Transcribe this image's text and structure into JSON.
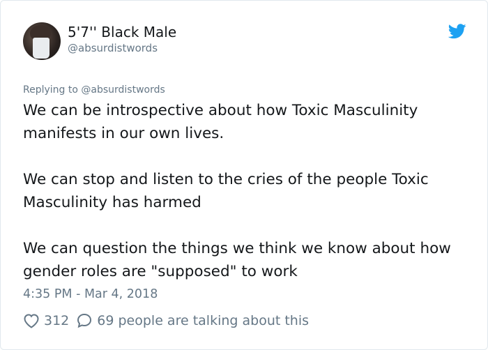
{
  "tweet": {
    "display_name": "5'7'' Black Male",
    "handle": "@absurdistwords",
    "replying_to": "Replying to @absurdistwords",
    "paragraphs": [
      "We can be introspective about how Toxic Masculinity manifests in our own lives.",
      "We can stop and listen to the cries of the people Toxic Masculinity has harmed",
      "We can question the things we think we know about how gender roles are \"supposed\" to work"
    ],
    "timestamp": "4:35 PM - Mar 4, 2018",
    "likes": "312",
    "talking": "69 people are talking about this"
  },
  "colors": {
    "text": "#14171a",
    "muted": "#657786",
    "twitter_blue": "#1da1f2",
    "border": "#e1e8ed"
  },
  "icons": [
    "twitter-bird-icon",
    "heart-icon",
    "comment-icon"
  ]
}
